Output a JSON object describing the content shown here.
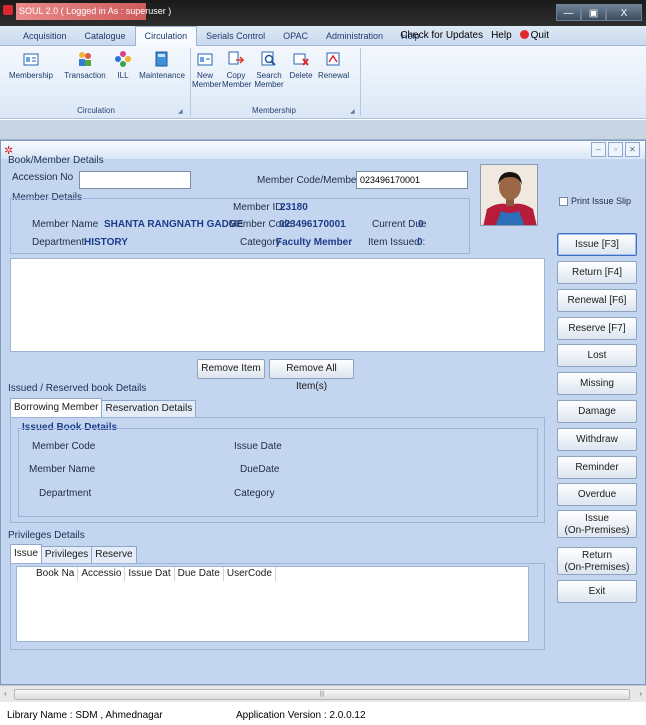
{
  "window": {
    "title": "SOUL 2.0  ( Logged in As : superuser )",
    "minimize": "—",
    "maximize": "▣",
    "close": "X"
  },
  "menu": {
    "items": [
      "Acquisition",
      "Catalogue",
      "Circulation",
      "Serials Control",
      "OPAC",
      "Administration",
      "Help"
    ],
    "active": "Circulation",
    "check_updates": "Check for Updates",
    "help": "Help",
    "quit": "Quit"
  },
  "ribbon": {
    "circulation_group": {
      "label": "Circulation",
      "buttons": [
        "Membership",
        "Transaction",
        "ILL",
        "Maintenance"
      ]
    },
    "membership_group": {
      "label": "Membership",
      "buttons": [
        "New Member",
        "Copy Member",
        "Search Member",
        "Delete",
        "Renewal"
      ]
    }
  },
  "book_member": {
    "group_title": "Book/Member Details",
    "accession_label": "Accession No",
    "accession_value": "",
    "member_code_label": "Member Code/Member ID",
    "member_code_value": "023496170001"
  },
  "member_details": {
    "group_title": "Member Details",
    "member_id_label": "Member ID",
    "member_id_value": "23180",
    "member_name_label": "Member Name",
    "member_name_value": "SHANTA RANGNATH GADGE",
    "member_code_label": "Member Code",
    "member_code_value": "023496170001",
    "current_due_label": "Current Due",
    "current_due_value": "0",
    "department_label": "Department",
    "department_value": "HISTORY",
    "category_label": "Category",
    "category_value": "Faculty Member",
    "item_issued_label": "Item Issued :",
    "item_issued_value": "0"
  },
  "item_buttons": {
    "remove_item": "Remove Item",
    "remove_all": "Remove All Item(s)"
  },
  "issued_reserved": {
    "group_title": "Issued / Reserved book Details",
    "tabs": [
      "Borrowing Member",
      "Reservation Details"
    ],
    "active_tab": "Borrowing Member",
    "sub_title": "Issued Book Details",
    "member_code_label": "Member Code",
    "member_name_label": "Member Name",
    "department_label": "Department",
    "issue_date_label": "Issue Date",
    "due_date_label": "DueDate",
    "category_label": "Category"
  },
  "privileges": {
    "group_title": "Privileges Details",
    "tabs": [
      "Issue",
      "Privileges",
      "Reserve"
    ],
    "active_tab": "Issue",
    "columns": [
      "Book Na",
      "Accessio",
      "Issue Dat",
      "Due Date",
      "UserCode"
    ]
  },
  "side": {
    "print_issue_slip": "Print Issue Slip",
    "buttons": [
      "Issue [F3]",
      "Return [F4]",
      "Renewal [F6]",
      "Reserve [F7]",
      "Lost",
      "Missing",
      "Damage",
      "Withdraw",
      "Reminder",
      "Overdue"
    ],
    "issue_on_premises": [
      "Issue",
      "(On-Premises)"
    ],
    "return_on_premises": [
      "Return",
      "(On-Premises)"
    ],
    "exit": "Exit"
  },
  "status": {
    "library": "Library Name : SDM , Ahmednagar",
    "version": "Application Version : 2.0.0.12"
  },
  "colors": {
    "accent": "#1c3c8a",
    "panel_bg": "#c4d6ef",
    "quit_red": "#e3272b"
  }
}
